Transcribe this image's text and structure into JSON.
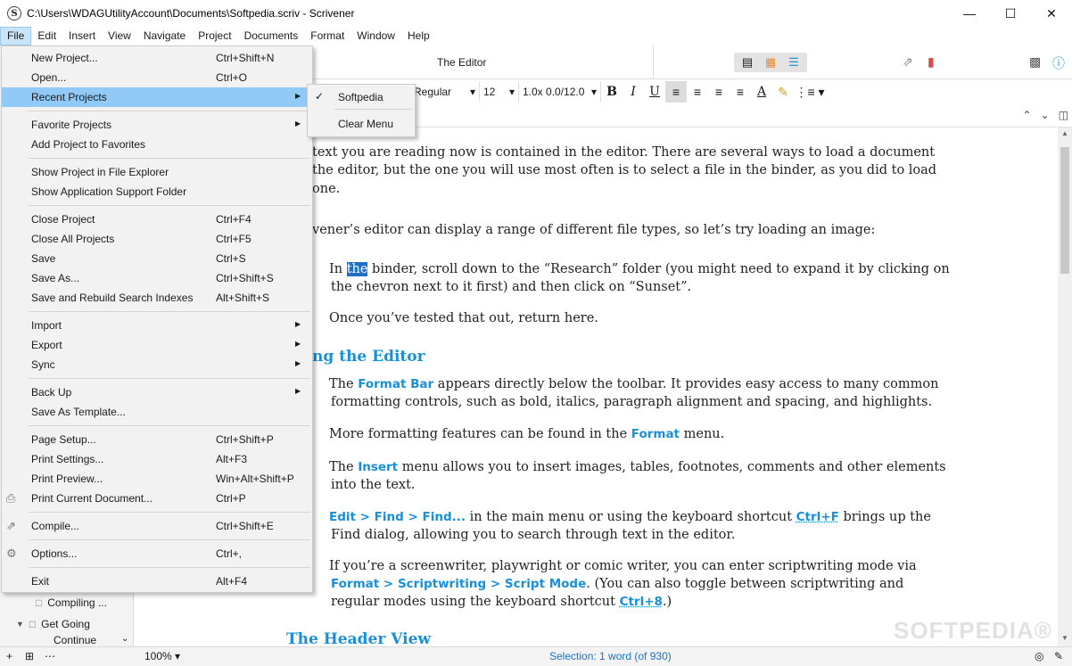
{
  "window": {
    "title": "C:\\Users\\WDAGUtilityAccount\\Documents\\Softpedia.scriv - Scrivener",
    "app_icon": "S"
  },
  "menubar": [
    "File",
    "Edit",
    "Insert",
    "View",
    "Navigate",
    "Project",
    "Documents",
    "Format",
    "Window",
    "Help"
  ],
  "toolbar": {
    "editor_title": "The Editor"
  },
  "formatbar": {
    "style": "Regular",
    "size": "12",
    "spacing": "1.0x 0.0/12.0"
  },
  "binder": {
    "items": [
      "Compiling ...",
      "Get Going",
      "Continue"
    ]
  },
  "file_menu": {
    "new_project": {
      "label": "New Project...",
      "shortcut": "Ctrl+Shift+N"
    },
    "open": {
      "label": "Open...",
      "shortcut": "Ctrl+O"
    },
    "recent_projects": {
      "label": "Recent Projects"
    },
    "favorite_projects": {
      "label": "Favorite Projects"
    },
    "add_favorites": {
      "label": "Add Project to Favorites"
    },
    "show_explorer": {
      "label": "Show Project in File Explorer"
    },
    "show_support": {
      "label": "Show Application Support Folder"
    },
    "close_project": {
      "label": "Close Project",
      "shortcut": "Ctrl+F4"
    },
    "close_all": {
      "label": "Close All Projects",
      "shortcut": "Ctrl+F5"
    },
    "save": {
      "label": "Save",
      "shortcut": "Ctrl+S"
    },
    "save_as": {
      "label": "Save As...",
      "shortcut": "Ctrl+Shift+S"
    },
    "save_rebuild": {
      "label": "Save and Rebuild Search Indexes",
      "shortcut": "Alt+Shift+S"
    },
    "import": {
      "label": "Import"
    },
    "export": {
      "label": "Export"
    },
    "sync": {
      "label": "Sync"
    },
    "back_up": {
      "label": "Back Up"
    },
    "save_template": {
      "label": "Save As Template..."
    },
    "page_setup": {
      "label": "Page Setup...",
      "shortcut": "Ctrl+Shift+P"
    },
    "print_settings": {
      "label": "Print Settings...",
      "shortcut": "Alt+F3"
    },
    "print_preview": {
      "label": "Print Preview...",
      "shortcut": "Win+Alt+Shift+P"
    },
    "print_current": {
      "label": "Print Current Document...",
      "shortcut": "Ctrl+P"
    },
    "compile": {
      "label": "Compile...",
      "shortcut": "Ctrl+Shift+E"
    },
    "options": {
      "label": "Options...",
      "shortcut": "Ctrl+,"
    },
    "exit": {
      "label": "Exit",
      "shortcut": "Alt+F4"
    }
  },
  "recent_submenu": {
    "item": "Softpedia",
    "clear": "Clear Menu"
  },
  "editor": {
    "p1a": "text you are reading now is contained in the editor. There are several ways to load a document",
    "p1b": "the editor, but the one you will use most often is to select a file in the binder, as you did to load",
    "p1c": "one.",
    "p2": "vener’s editor can display a range of different file types, so let’s try loading an image:",
    "p3_in": "In ",
    "p3_sel": "the",
    "p3_rest": " binder, scroll down to the “Research” folder (you might need to expand it by clicking on",
    "p3b": "the chevron next to it first) and then click on “Sunset”.",
    "p4": "Once you’ve tested that out, return here.",
    "h1": "ng the Editor",
    "p5_pre": "The ",
    "p5_hl": "Format Bar",
    "p5_post": " appears directly below the toolbar. It provides easy access to many common",
    "p5b": "formatting controls, such as bold, italics, paragraph alignment and spacing, and highlights.",
    "p6_pre": "More formatting features can be found in the ",
    "p6_hl": "Format",
    "p6_post": " menu.",
    "p7_pre": "The ",
    "p7_hl": "Insert",
    "p7_post": " menu allows you to insert images, tables, footnotes, comments and other elements",
    "p7b": "into the text.",
    "p8_hl": "Edit > Find > Find...",
    "p8_mid": " in the main menu or using the keyboard shortcut ",
    "p8_kb": "Ctrl+F",
    "p8_post": " brings up the",
    "p8b": "Find dialog, allowing you to search through text in the editor.",
    "p9": "If you’re a screenwriter, playwright or comic writer, you can enter scriptwriting mode via",
    "p9b_hl": "Format > Scriptwriting > Script Mode",
    "p9b_post": ". (You can also toggle between scriptwriting and",
    "p9c_pre": "regular modes using the keyboard shortcut ",
    "p9c_kb": "Ctrl+8",
    "p9c_post": ".)",
    "h2": "The Header View"
  },
  "statusbar": {
    "zoom": "100%",
    "selection": "Selection: 1 word (of 930)"
  },
  "watermark": "SOFTPEDIA®",
  "colors": {
    "accent": "#1a8fd9",
    "menu_highlight": "#91c9f7",
    "selection": "#1f6fc7"
  }
}
